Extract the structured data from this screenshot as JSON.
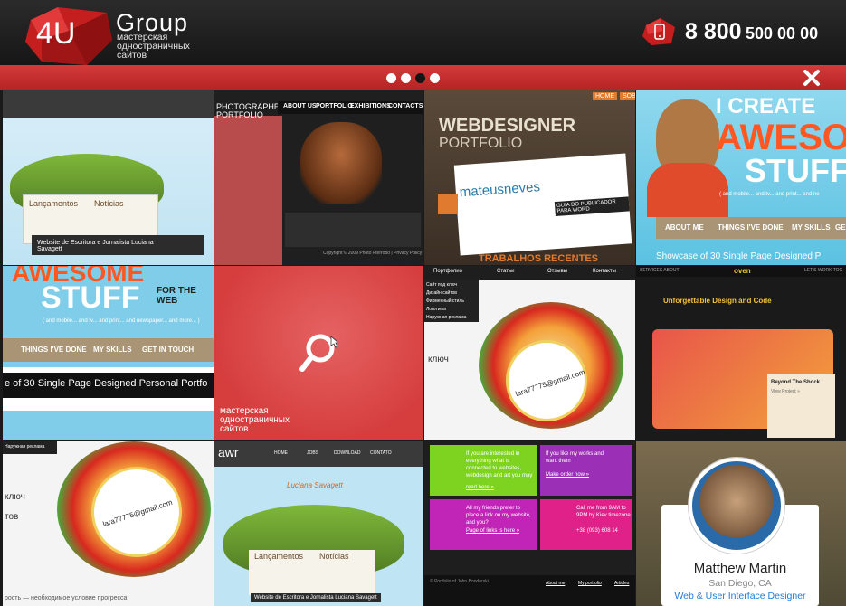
{
  "header": {
    "brand_mark": "4U",
    "brand_name": "Group",
    "brand_tagline": "мастерская одностраничных сайтов",
    "phone_prefix": "8 800",
    "phone_number": "500 00 00",
    "phone_icon": "phone-icon"
  },
  "slider": {
    "dots_count": 4,
    "active_dot": 3,
    "close_icon": "close-icon"
  },
  "tiles": {
    "t1": {
      "caption": "Website de Escritora e Jornalista Luciana Savagett",
      "heading_left": "Lançamentos",
      "heading_right": "Notícias"
    },
    "t2": {
      "title": "PHOTOGRAPHER'S PORTFOLIO",
      "nav": [
        "ABOUT US",
        "PORTFOLIO",
        "EXHIBITIONS",
        "CONTACTS"
      ],
      "copyright": "Copyright © 2009 Photo Pterrobo | Privacy Policy"
    },
    "t3": {
      "title_top": "WEBDESIGNER",
      "title_bottom": "PORTFOLIO",
      "tab_home": "HOME",
      "tab_other": "SOBR",
      "brand": "mateusneves",
      "guide": "GUIA DO PUBLICADOR PARA WORD",
      "works": "TRABALHOS RECENTES"
    },
    "t4": {
      "line1": "I CREATE",
      "line2": "AWESO",
      "line3": "STUFF",
      "tag": "( and mobile... and tv... and print... and ne",
      "nav": [
        "ABOUT ME",
        "THINGS I'VE DONE",
        "MY SKILLS",
        "GE"
      ],
      "showcase": "Showcase of 30 Single Page Designed P"
    },
    "t5": {
      "line1": "AWESOME",
      "line2": "STUFF",
      "line3": "FOR THE WEB",
      "tag": "( and mobile... and tv... and print... and newspaper... and more... )",
      "nav": [
        "THINGS I'VE DONE",
        "MY SKILLS",
        "GET IN TOUCH"
      ],
      "band": "e of 30 Single Page Designed Personal Portfo"
    },
    "t6": {
      "label": "мастерская одностраничных сайтов",
      "search_icon": "magnifier-icon"
    },
    "t7": {
      "nav": [
        "Портфолио",
        "Статьи",
        "Отзывы",
        "Контакты"
      ],
      "menu": [
        "Сайт под ключ",
        "Дизайн сайтов",
        "Фирменный стиль",
        "Логотипы",
        "Наружная реклама"
      ],
      "email": "lara77775@gmail.com",
      "side_text": "ключ"
    },
    "t8": {
      "brand": "oven",
      "top_left": "SERVICES   ABOUT",
      "top_right": "LET'S WORK TOG",
      "headline": "Unforgettable Design and Code",
      "card_title": "Beyond The Shock",
      "card_link": "View Project »"
    },
    "t9": {
      "menu_item": "Наружная реклама",
      "email": "lara77775@gmail.com",
      "side_text": "ключ",
      "side_text2": "тов",
      "footer": "рость — необходимое условие прогресса!"
    },
    "t10": {
      "brand": "awr",
      "nav": [
        "HOME",
        "JOBS",
        "DOWNLOAD",
        "CONTATO"
      ],
      "title": "Luciana Savagett",
      "heading_left": "Lançamentos",
      "heading_right": "Notícias",
      "caption": "Website de Escritora e Jornalista Luciana Savagett"
    },
    "t11": {
      "b1": "If you are interested in everything what is connected to websites, webdesign and art you may",
      "b1_link": "read here »",
      "b2": "If you like my works and want them",
      "b2_link": "Make order now »",
      "b3": "All my friends prefer to place a link on my website, and you?",
      "b3_link": "Page of links is here »",
      "b4": "Call me from 9AM to 9PM by Kiev timezone",
      "b4_phone": "+38 (093) 608 14",
      "footer_nav": [
        "About me",
        "My portfolio",
        "Articles"
      ],
      "copyright": "© Portfolio of John Bonderski"
    },
    "t12": {
      "name": "Matthew Martin",
      "location": "San Diego, CA",
      "role": "Web & User Interface Designer"
    }
  },
  "colors": {
    "accent": "#c42a2a",
    "header_bg": "#1e1e1e",
    "highlight_tile": "#d94040"
  }
}
